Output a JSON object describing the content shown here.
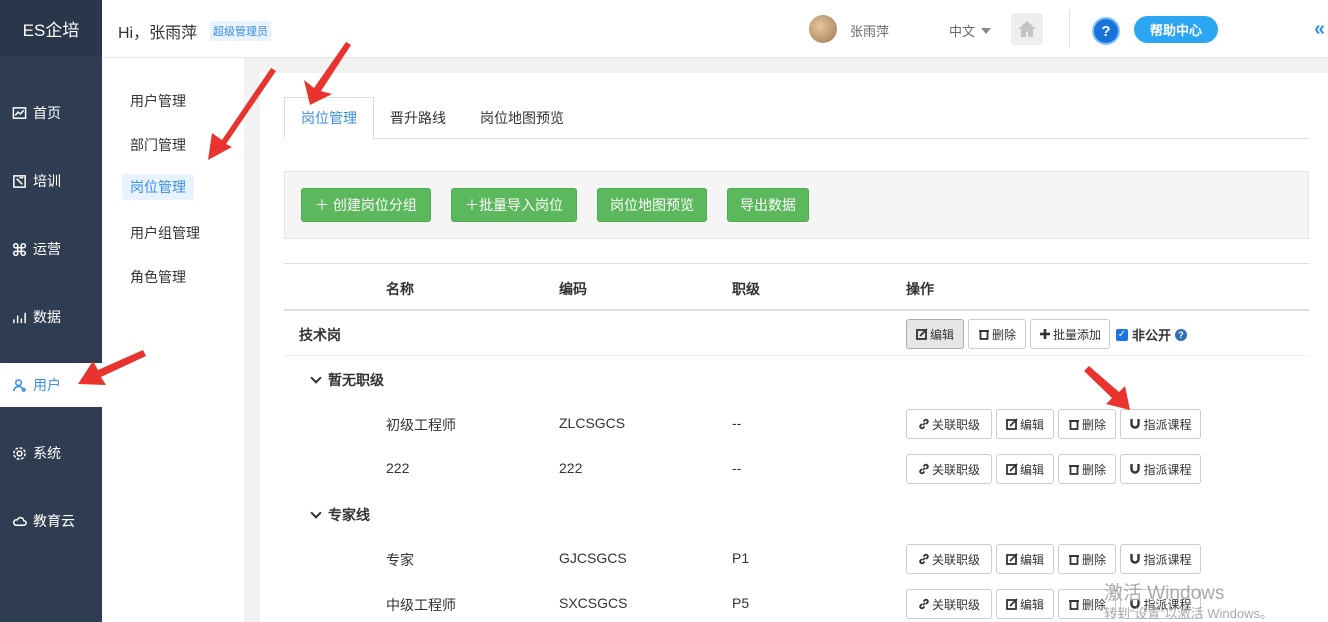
{
  "app": {
    "brand": "ES企培"
  },
  "header": {
    "greeting": "Hi，张雨萍",
    "role_badge": "超级管理员",
    "username": "张雨萍",
    "language": "中文",
    "help_label": "帮助中心",
    "help_icon": "?",
    "collapse_glyph": "«"
  },
  "sidebar": {
    "items": [
      {
        "label": "首页",
        "icon": "dashboard-icon"
      },
      {
        "label": "培训",
        "icon": "training-icon"
      },
      {
        "label": "运营",
        "icon": "command-icon"
      },
      {
        "label": "数据",
        "icon": "chart-icon"
      },
      {
        "label": "用户",
        "icon": "user-icon",
        "active": true
      },
      {
        "label": "系统",
        "icon": "gear-icon"
      },
      {
        "label": "教育云",
        "icon": "cloud-icon"
      }
    ]
  },
  "subnav": {
    "items": [
      {
        "label": "用户管理"
      },
      {
        "label": "部门管理"
      },
      {
        "label": "岗位管理",
        "active": true
      },
      {
        "label": "用户组管理"
      },
      {
        "label": "角色管理"
      }
    ]
  },
  "tabs": [
    {
      "label": "岗位管理",
      "active": true
    },
    {
      "label": "晋升路线"
    },
    {
      "label": "岗位地图预览"
    }
  ],
  "toolbar": {
    "create_group": "＋ 创建岗位分组",
    "batch_import": "＋批量导入岗位",
    "map_preview": "岗位地图预览",
    "export": "导出数据"
  },
  "table": {
    "headers": {
      "name": "名称",
      "code": "编码",
      "level": "职级",
      "ops": "操作"
    },
    "category": {
      "name": "技术岗",
      "edit": "编辑",
      "delete": "删除",
      "batch_add": "批量添加",
      "private_label": "非公开",
      "private_checked": true
    },
    "groups": [
      {
        "name": "暂无职级",
        "rows": [
          {
            "name": "初级工程师",
            "code": "ZLCSGCS",
            "level": "--"
          },
          {
            "name": "222",
            "code": "222",
            "level": "--"
          }
        ]
      },
      {
        "name": "专家线",
        "rows": [
          {
            "name": "专家",
            "code": "GJCSGCS",
            "level": "P1"
          },
          {
            "name": "中级工程师",
            "code": "SXCSGCS",
            "level": "P5"
          }
        ]
      }
    ],
    "row_actions": {
      "link_level": "关联职级",
      "edit": "编辑",
      "delete": "删除",
      "assign_course": "指派课程"
    }
  },
  "watermark": {
    "line1": "激活 Windows",
    "line2": "转到“设置”以激活 Windows。"
  },
  "colors": {
    "sidebar": "#2f3d52",
    "accent": "#3a8ee6",
    "green": "#5cb85c",
    "arrow": "#e8332e"
  }
}
